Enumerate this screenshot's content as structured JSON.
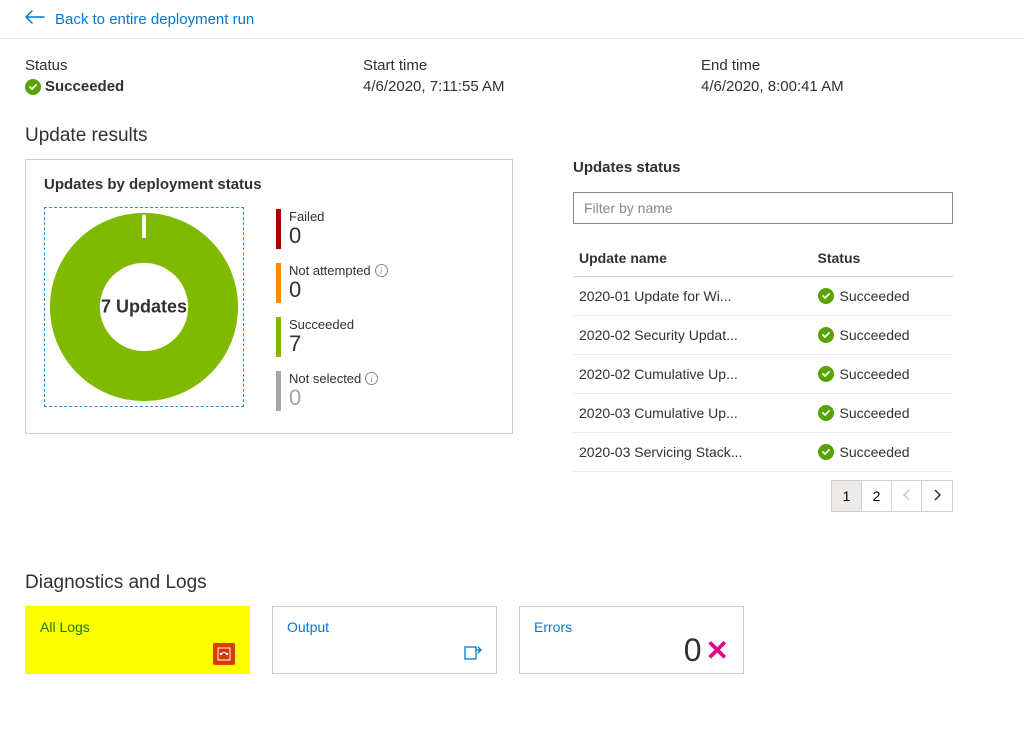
{
  "back_link": "Back to entire deployment run",
  "status": {
    "label": "Status",
    "value": "Succeeded"
  },
  "start_time": {
    "label": "Start time",
    "value": "4/6/2020, 7:11:55 AM"
  },
  "end_time": {
    "label": "End time",
    "value": "4/6/2020, 8:00:41 AM"
  },
  "results": {
    "title": "Update results",
    "card_title": "Updates by deployment status",
    "center": "7 Updates",
    "legend": {
      "failed": {
        "label": "Failed",
        "value": "0",
        "color": "#a80000"
      },
      "not_attempted": {
        "label": "Not attempted",
        "value": "0",
        "color": "#ff8c00"
      },
      "succeeded": {
        "label": "Succeeded",
        "value": "7",
        "color": "#7fba00"
      },
      "not_selected": {
        "label": "Not selected",
        "value": "0",
        "color": "#a6a6a6"
      }
    }
  },
  "chart_data": {
    "type": "pie",
    "title": "Updates by deployment status",
    "categories": [
      "Failed",
      "Not attempted",
      "Succeeded",
      "Not selected"
    ],
    "values": [
      0,
      0,
      7,
      0
    ],
    "colors": [
      "#a80000",
      "#ff8c00",
      "#7fba00",
      "#a6a6a6"
    ],
    "center_label": "7 Updates"
  },
  "updates_status": {
    "title": "Updates status",
    "filter_placeholder": "Filter by name",
    "headers": {
      "name": "Update name",
      "status": "Status"
    },
    "rows": [
      {
        "name": "2020-01 Update for Wi...",
        "status": "Succeeded"
      },
      {
        "name": "2020-02 Security Updat...",
        "status": "Succeeded"
      },
      {
        "name": "2020-02 Cumulative Up...",
        "status": "Succeeded"
      },
      {
        "name": "2020-03 Cumulative Up...",
        "status": "Succeeded"
      },
      {
        "name": "2020-03 Servicing Stack...",
        "status": "Succeeded"
      }
    ],
    "pager": {
      "current": "1",
      "next": "2"
    }
  },
  "diagnostics": {
    "title": "Diagnostics and Logs",
    "all_logs": "All Logs",
    "output": "Output",
    "errors": "Errors",
    "errors_count": "0"
  }
}
